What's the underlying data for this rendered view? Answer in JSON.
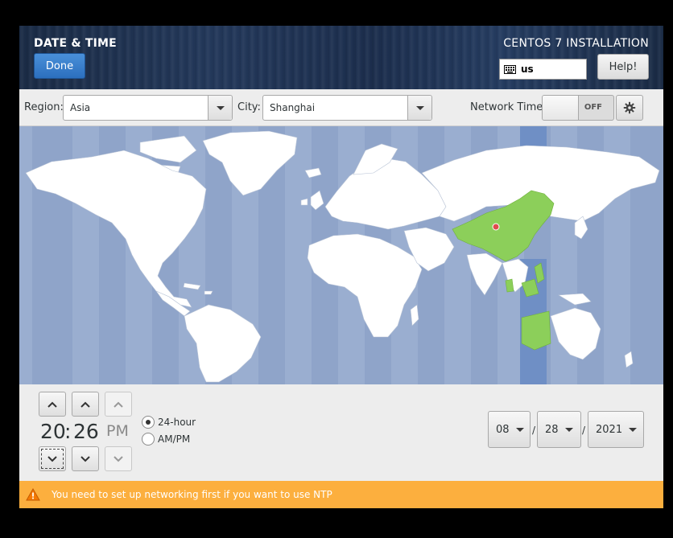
{
  "header": {
    "spoke_title": "DATE & TIME",
    "done_label": "Done",
    "product_title": "CENTOS 7 INSTALLATION",
    "keyboard_layout": "us",
    "help_label": "Help!"
  },
  "controls": {
    "region_label": "Region:",
    "region_value": "Asia",
    "city_label": "City:",
    "city_value": "Shanghai",
    "network_time_label": "Network Time",
    "network_time_state": "OFF"
  },
  "map": {
    "ocean_color": "#8fa4c9",
    "land_color": "#ffffff",
    "selected_zone_color": "#8ccf5a",
    "selected_band_color": "#6f8fc5",
    "marker_color": "#e04c4c"
  },
  "time": {
    "hours": "20",
    "separator": ":",
    "minutes": "26",
    "ampm": "PM",
    "format_24_label": "24-hour",
    "format_ampm_label": "AM/PM",
    "selected_format": "24-hour"
  },
  "date": {
    "month": "08",
    "day": "28",
    "year": "2021",
    "separator": "/"
  },
  "infobar": {
    "message": "You need to set up networking first if you want to use NTP",
    "color": "#fcaf3e",
    "icon": "warning-icon"
  }
}
